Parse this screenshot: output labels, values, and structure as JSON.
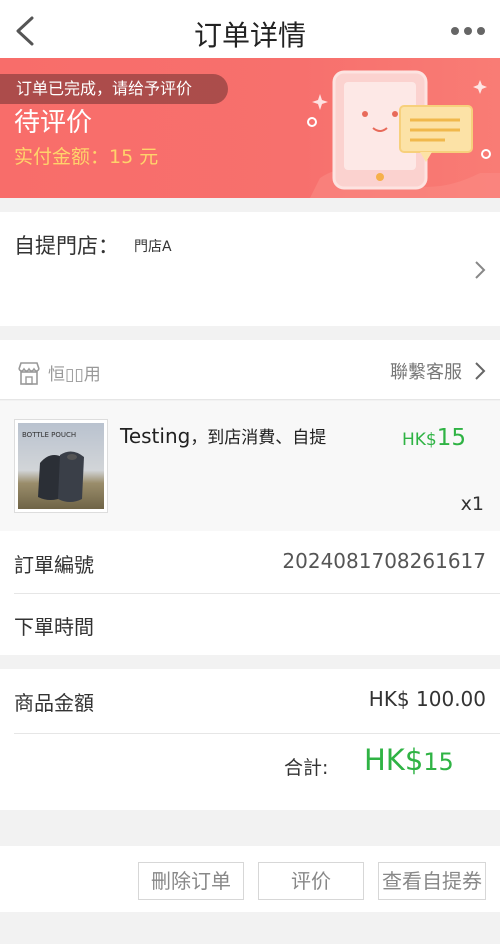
{
  "header": {
    "title": "订单详情"
  },
  "banner": {
    "tip": "订单已完成，请给予评价",
    "status": "待评价",
    "paid_label": "实付金额：",
    "paid_amount": "15 元"
  },
  "pickup": {
    "label": "自提門店：",
    "store": "門店A"
  },
  "store": {
    "name": "恒▯▯用",
    "customer_service": "聯繫客服"
  },
  "product": {
    "name": "Testing",
    "tags": "，到店消費、自提",
    "price_currency": "HK$",
    "price_value": "15",
    "quantity": "x1",
    "thumbnail_text": "BOTTLE POUCH"
  },
  "order_info": {
    "order_no_label": "訂單編號",
    "order_no": "2024081708261617",
    "order_time_label": "下單時間",
    "order_time": ""
  },
  "amount": {
    "goods_label": "商品金額",
    "goods_value": "HK$ 100.00",
    "total_label": "合計:",
    "total_currency": "HK$",
    "total_value": "15"
  },
  "actions": {
    "delete": "刪除订单",
    "review": "评价",
    "view_pickup": "查看自提券"
  },
  "colors": {
    "accent_green": "#2fb344",
    "banner_red": "#f86d6a",
    "paid_yellow": "#ffd36b"
  }
}
